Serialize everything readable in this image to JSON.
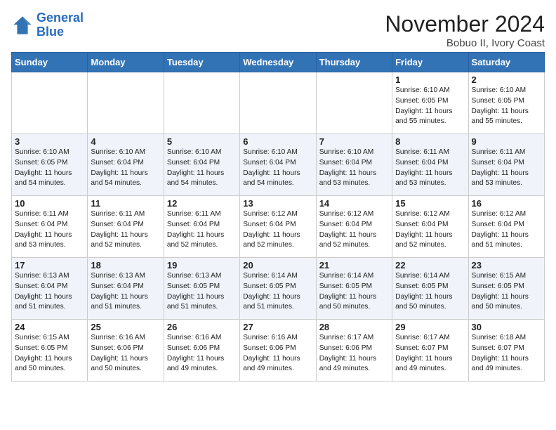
{
  "header": {
    "logo_line1": "General",
    "logo_line2": "Blue",
    "month_title": "November 2024",
    "location": "Bobuo II, Ivory Coast"
  },
  "weekdays": [
    "Sunday",
    "Monday",
    "Tuesday",
    "Wednesday",
    "Thursday",
    "Friday",
    "Saturday"
  ],
  "weeks": [
    [
      {
        "day": "",
        "info": ""
      },
      {
        "day": "",
        "info": ""
      },
      {
        "day": "",
        "info": ""
      },
      {
        "day": "",
        "info": ""
      },
      {
        "day": "",
        "info": ""
      },
      {
        "day": "1",
        "info": "Sunrise: 6:10 AM\nSunset: 6:05 PM\nDaylight: 11 hours\nand 55 minutes."
      },
      {
        "day": "2",
        "info": "Sunrise: 6:10 AM\nSunset: 6:05 PM\nDaylight: 11 hours\nand 55 minutes."
      }
    ],
    [
      {
        "day": "3",
        "info": "Sunrise: 6:10 AM\nSunset: 6:05 PM\nDaylight: 11 hours\nand 54 minutes."
      },
      {
        "day": "4",
        "info": "Sunrise: 6:10 AM\nSunset: 6:04 PM\nDaylight: 11 hours\nand 54 minutes."
      },
      {
        "day": "5",
        "info": "Sunrise: 6:10 AM\nSunset: 6:04 PM\nDaylight: 11 hours\nand 54 minutes."
      },
      {
        "day": "6",
        "info": "Sunrise: 6:10 AM\nSunset: 6:04 PM\nDaylight: 11 hours\nand 54 minutes."
      },
      {
        "day": "7",
        "info": "Sunrise: 6:10 AM\nSunset: 6:04 PM\nDaylight: 11 hours\nand 53 minutes."
      },
      {
        "day": "8",
        "info": "Sunrise: 6:11 AM\nSunset: 6:04 PM\nDaylight: 11 hours\nand 53 minutes."
      },
      {
        "day": "9",
        "info": "Sunrise: 6:11 AM\nSunset: 6:04 PM\nDaylight: 11 hours\nand 53 minutes."
      }
    ],
    [
      {
        "day": "10",
        "info": "Sunrise: 6:11 AM\nSunset: 6:04 PM\nDaylight: 11 hours\nand 53 minutes."
      },
      {
        "day": "11",
        "info": "Sunrise: 6:11 AM\nSunset: 6:04 PM\nDaylight: 11 hours\nand 52 minutes."
      },
      {
        "day": "12",
        "info": "Sunrise: 6:11 AM\nSunset: 6:04 PM\nDaylight: 11 hours\nand 52 minutes."
      },
      {
        "day": "13",
        "info": "Sunrise: 6:12 AM\nSunset: 6:04 PM\nDaylight: 11 hours\nand 52 minutes."
      },
      {
        "day": "14",
        "info": "Sunrise: 6:12 AM\nSunset: 6:04 PM\nDaylight: 11 hours\nand 52 minutes."
      },
      {
        "day": "15",
        "info": "Sunrise: 6:12 AM\nSunset: 6:04 PM\nDaylight: 11 hours\nand 52 minutes."
      },
      {
        "day": "16",
        "info": "Sunrise: 6:12 AM\nSunset: 6:04 PM\nDaylight: 11 hours\nand 51 minutes."
      }
    ],
    [
      {
        "day": "17",
        "info": "Sunrise: 6:13 AM\nSunset: 6:04 PM\nDaylight: 11 hours\nand 51 minutes."
      },
      {
        "day": "18",
        "info": "Sunrise: 6:13 AM\nSunset: 6:04 PM\nDaylight: 11 hours\nand 51 minutes."
      },
      {
        "day": "19",
        "info": "Sunrise: 6:13 AM\nSunset: 6:05 PM\nDaylight: 11 hours\nand 51 minutes."
      },
      {
        "day": "20",
        "info": "Sunrise: 6:14 AM\nSunset: 6:05 PM\nDaylight: 11 hours\nand 51 minutes."
      },
      {
        "day": "21",
        "info": "Sunrise: 6:14 AM\nSunset: 6:05 PM\nDaylight: 11 hours\nand 50 minutes."
      },
      {
        "day": "22",
        "info": "Sunrise: 6:14 AM\nSunset: 6:05 PM\nDaylight: 11 hours\nand 50 minutes."
      },
      {
        "day": "23",
        "info": "Sunrise: 6:15 AM\nSunset: 6:05 PM\nDaylight: 11 hours\nand 50 minutes."
      }
    ],
    [
      {
        "day": "24",
        "info": "Sunrise: 6:15 AM\nSunset: 6:05 PM\nDaylight: 11 hours\nand 50 minutes."
      },
      {
        "day": "25",
        "info": "Sunrise: 6:16 AM\nSunset: 6:06 PM\nDaylight: 11 hours\nand 50 minutes."
      },
      {
        "day": "26",
        "info": "Sunrise: 6:16 AM\nSunset: 6:06 PM\nDaylight: 11 hours\nand 49 minutes."
      },
      {
        "day": "27",
        "info": "Sunrise: 6:16 AM\nSunset: 6:06 PM\nDaylight: 11 hours\nand 49 minutes."
      },
      {
        "day": "28",
        "info": "Sunrise: 6:17 AM\nSunset: 6:06 PM\nDaylight: 11 hours\nand 49 minutes."
      },
      {
        "day": "29",
        "info": "Sunrise: 6:17 AM\nSunset: 6:07 PM\nDaylight: 11 hours\nand 49 minutes."
      },
      {
        "day": "30",
        "info": "Sunrise: 6:18 AM\nSunset: 6:07 PM\nDaylight: 11 hours\nand 49 minutes."
      }
    ]
  ]
}
